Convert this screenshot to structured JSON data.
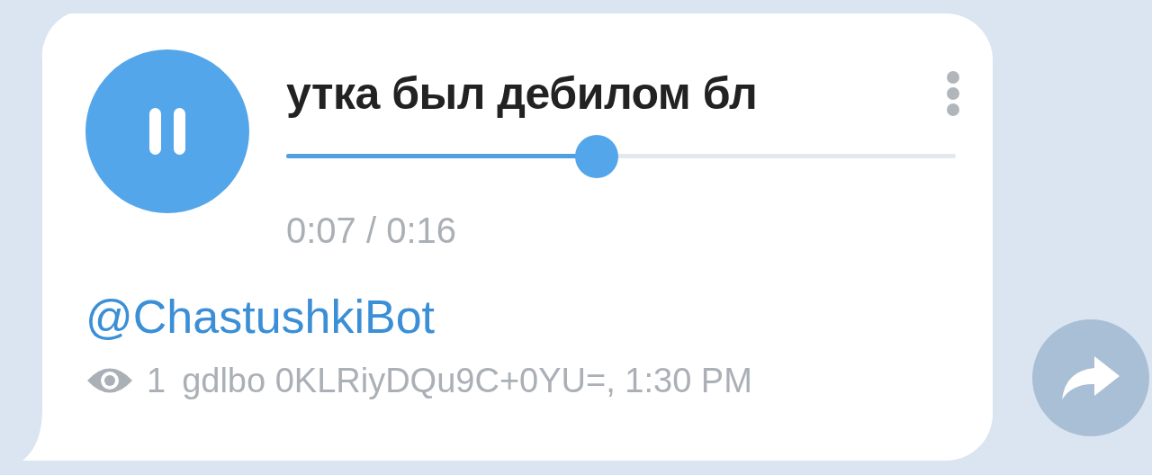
{
  "player": {
    "playing": true,
    "title": "утка был дебилом бл",
    "level": 0.464,
    "time": "0:07 / 0:16"
  },
  "via_bot": "@ChastushkiBot",
  "footer": {
    "views": "1",
    "signature": "gdlbo 0KLRiyDQu9C+0YU=, 1:30 PM"
  }
}
